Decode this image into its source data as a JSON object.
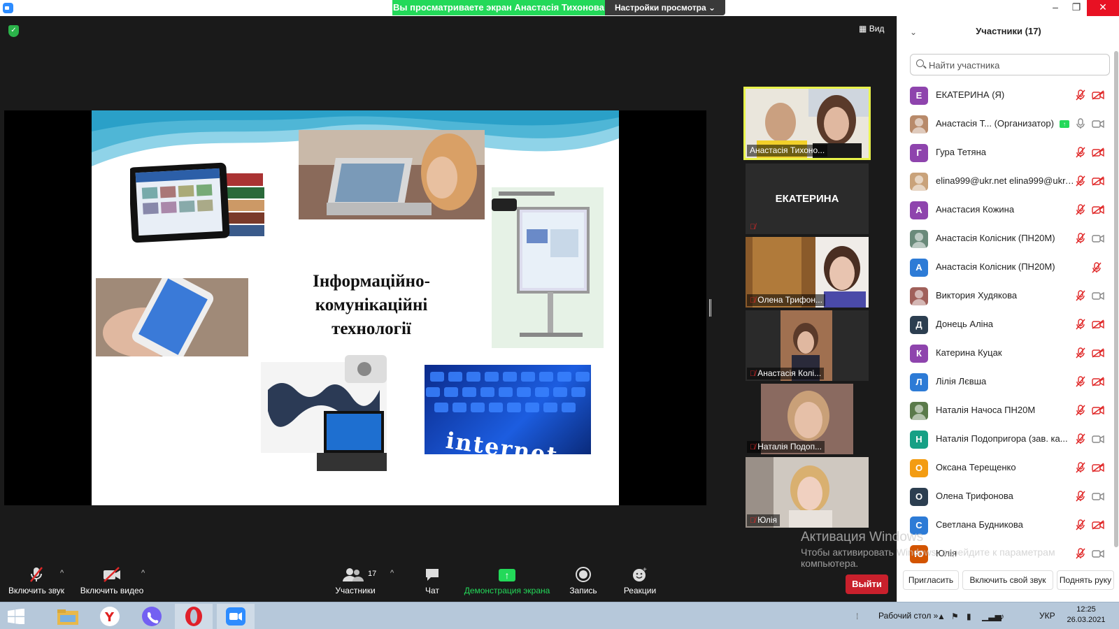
{
  "titlebar": {
    "viewing_banner": "Вы просматриваете экран Анастасія Тихонова",
    "view_options": "Настройки просмотра ⌄",
    "minimize": "–",
    "restore": "❐",
    "close": "✕"
  },
  "stage": {
    "view_button": "Вид",
    "slide_title_lines": [
      "Інформаційно-",
      "комунікаційні",
      "технології"
    ],
    "slide_internet_word": "internet"
  },
  "videos": [
    {
      "name": "Анастасія Тихоно...",
      "active": true,
      "muted": false
    },
    {
      "name": "ЕКАТЕРИНА",
      "muted": true,
      "name_only": true
    },
    {
      "name": "Олена Трифон...",
      "muted": true
    },
    {
      "name": "Анастасія Колі...",
      "muted": true
    },
    {
      "name": "Наталія Подоп...",
      "muted": true
    },
    {
      "name": "Юлія",
      "muted": true
    }
  ],
  "toolbar": {
    "unmute_label": "Включить звук",
    "start_video_label": "Включить видео",
    "participants_label": "Участники",
    "participants_count": "17",
    "chat_label": "Чат",
    "share_label": "Демонстрация экрана",
    "record_label": "Запись",
    "reactions_label": "Реакции",
    "leave_label": "Выйти"
  },
  "activation": {
    "line1": "Активация Windows",
    "line2": "Чтобы активировать Windows, перейдите к параметрам",
    "line3": "компьютера."
  },
  "panel": {
    "title": "Участники (17)",
    "search_placeholder": "Найти участника",
    "participants": [
      {
        "initial": "Е",
        "color": "#8e44ad",
        "name": "ЕКАТЕРИНА (Я)",
        "mic": "muted",
        "cam": "off"
      },
      {
        "initial": "",
        "color": "#b88a6a",
        "name": "Анастасія Т...  (Организатор)",
        "mic": "on",
        "cam": "on",
        "sharing": true
      },
      {
        "initial": "Г",
        "color": "#8e44ad",
        "name": " Гура Тетяна",
        "mic": "muted",
        "cam": "off"
      },
      {
        "initial": "",
        "color": "#c9a27a",
        "name": "elina999@ukr.net elina999@ukr.net",
        "mic": "muted",
        "cam": "off"
      },
      {
        "initial": "А",
        "color": "#8e44ad",
        "name": "Анастасия Кожина",
        "mic": "muted",
        "cam": "off"
      },
      {
        "initial": "",
        "color": "#6a8a7a",
        "name": "Анастасія Колісник (ПН20М)",
        "mic": "muted",
        "cam": "on"
      },
      {
        "initial": "А",
        "color": "#2d7bd6",
        "name": "Анастасія Колісник (ПН20М)",
        "mic": "none",
        "cam": "muted"
      },
      {
        "initial": "",
        "color": "#a0605a",
        "name": "Виктория Худякова",
        "mic": "muted",
        "cam": "on"
      },
      {
        "initial": "Д",
        "color": "#2c3e50",
        "name": "Донець Аліна",
        "mic": "muted",
        "cam": "off"
      },
      {
        "initial": "К",
        "color": "#8e44ad",
        "name": "Катерина Куцак",
        "mic": "muted",
        "cam": "off"
      },
      {
        "initial": "Л",
        "color": "#2d7bd6",
        "name": "Лілія Лєвша",
        "mic": "muted",
        "cam": "off"
      },
      {
        "initial": "",
        "color": "#5a7a4a",
        "name": "Наталія Начоса ПН20М",
        "mic": "muted",
        "cam": "off"
      },
      {
        "initial": "Н",
        "color": "#16a085",
        "name": "Наталія Подопригора (зав. ка...",
        "mic": "muted",
        "cam": "on"
      },
      {
        "initial": "О",
        "color": "#f39c12",
        "name": "Оксана Терещенко",
        "mic": "muted",
        "cam": "off"
      },
      {
        "initial": "О",
        "color": "#2c3e50",
        "name": "Олена Трифонова",
        "mic": "muted",
        "cam": "on"
      },
      {
        "initial": "С",
        "color": "#2d7bd6",
        "name": "Светлана Будникова",
        "mic": "muted",
        "cam": "off"
      },
      {
        "initial": "Ю",
        "color": "#d35400",
        "name": "Юлія",
        "mic": "muted",
        "cam": "on"
      }
    ],
    "invite_label": "Пригласить",
    "unmute_me_label": "Включить свой звук",
    "raise_hand_label": "Поднять руку"
  },
  "taskbar": {
    "toolbar_label": "Рабочий стол",
    "toolbar_chevron": "»",
    "language": "УКР",
    "time": "12:25",
    "date": "26.03.2021"
  }
}
